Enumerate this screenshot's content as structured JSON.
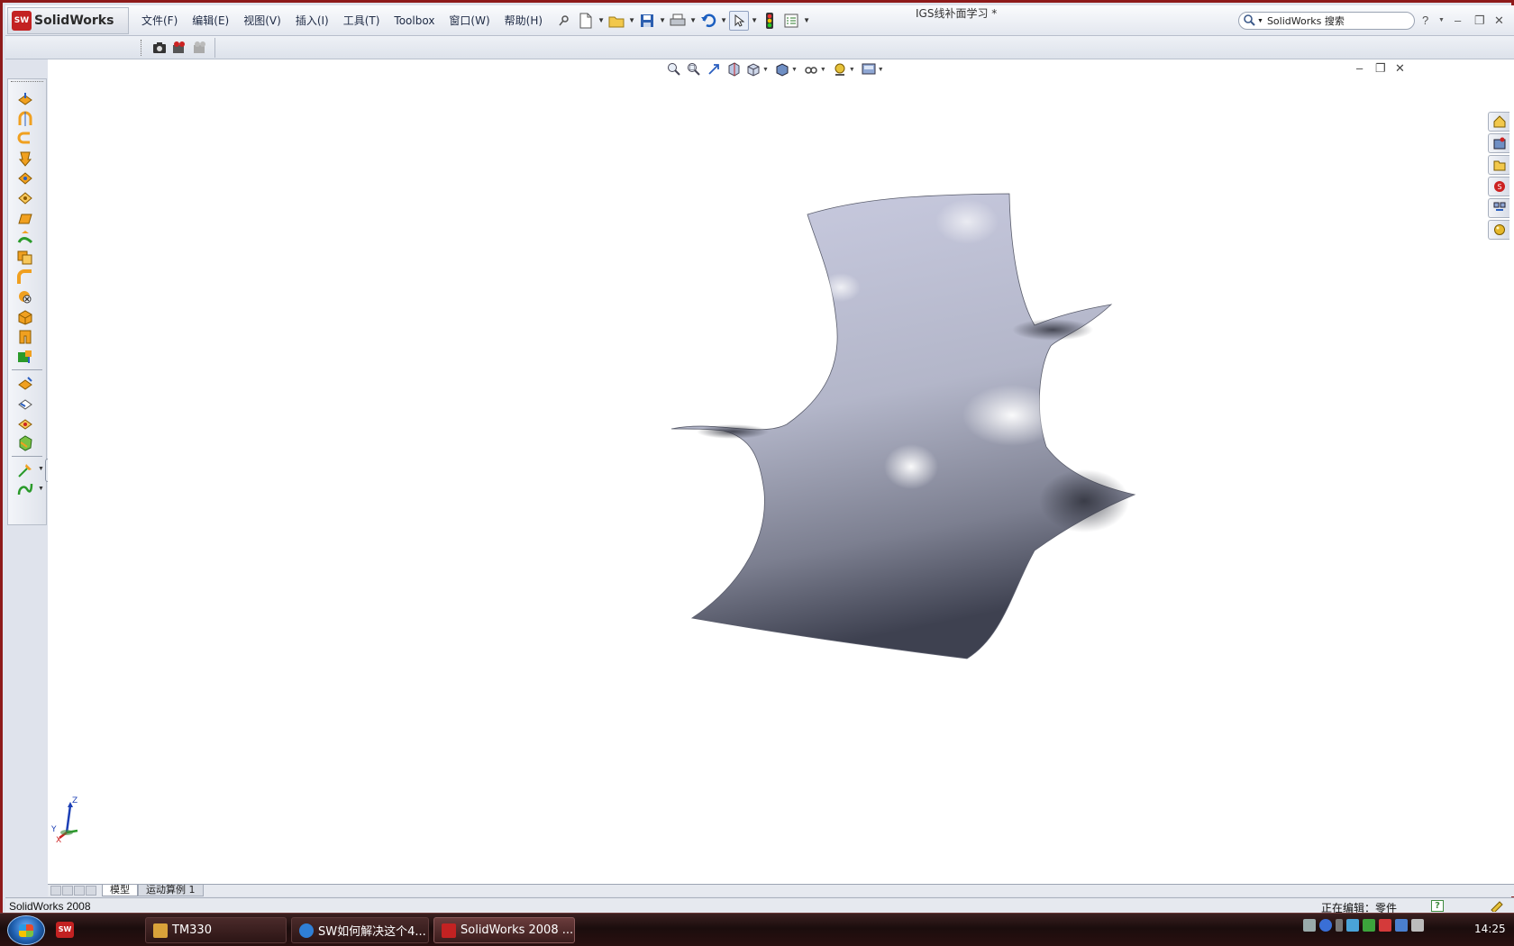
{
  "app": {
    "brand": "SolidWorks",
    "badge": "SW",
    "document_title": "IGS线补面学习 *"
  },
  "menu": [
    "文件(F)",
    "编辑(E)",
    "视图(V)",
    "插入(I)",
    "工具(T)",
    "Toolbox",
    "窗口(W)",
    "帮助(H)"
  ],
  "search": {
    "value": "SolidWorks 搜索"
  },
  "window_controls": {
    "help": "?",
    "minimize": "–",
    "restore": "❐",
    "close": "✕"
  },
  "viewport": {
    "controls": {
      "minimize": "–",
      "restore": "❐",
      "close": "✕"
    }
  },
  "triad": {
    "z": "Z",
    "y": "Y",
    "x": "X"
  },
  "tabs": [
    {
      "label": "模型",
      "active": true
    },
    {
      "label": "运动算例 1",
      "active": false
    }
  ],
  "status": {
    "left": "SolidWorks 2008",
    "editing": "正在编辑：零件",
    "help_icon": "?"
  },
  "taskbar": {
    "quicklaunch_badge": "SW",
    "tasks": [
      {
        "label": "TM330",
        "icon_color": "#d9a23a"
      },
      {
        "label": "SW如何解决这个4...",
        "icon_color": "#2f7fd6"
      },
      {
        "label": "SolidWorks 2008 ...",
        "icon_color": "#c32222"
      }
    ],
    "clock": "14:25"
  },
  "colors": {
    "frame": "#8e1a1a",
    "surface_light": "#c9cbe0",
    "surface_dark": "#3e4150",
    "toolbar_accent": "#f0a020"
  }
}
